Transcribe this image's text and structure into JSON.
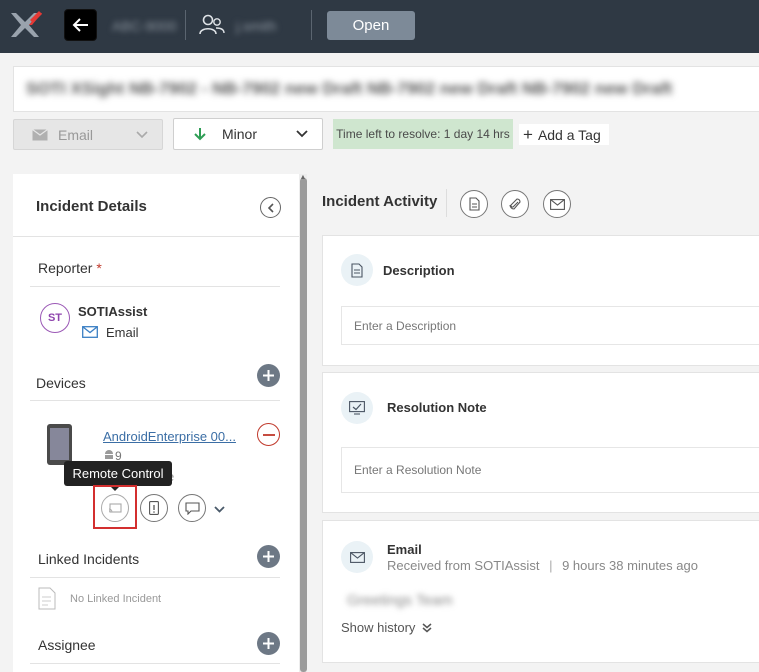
{
  "topbar": {
    "blurred_id": "ABC-9000",
    "blurred_name": "j.smith",
    "open_label": "Open"
  },
  "incident": {
    "title": "SOTI XSight NB-7902 - NB-7902 new Draft NB-7902 new Draft NB-7902 new Draft"
  },
  "toolbar": {
    "channel": "Email",
    "priority": "Minor",
    "time_left": "Time left to resolve: 1 day 14 hrs",
    "add_tag": "Add a Tag"
  },
  "details": {
    "title": "Incident Details",
    "reporter_label": "Reporter",
    "reporter_required": "*",
    "reporter_initials": "ST",
    "reporter_name": "SOTIAssist",
    "reporter_channel": "Email",
    "devices_label": "Devices",
    "device_name": "AndroidEnterprise 00...",
    "device_os_version": "9",
    "device_sub": "ance",
    "tooltip": "Remote Control",
    "linked_label": "Linked Incidents",
    "no_linked": "No Linked Incident",
    "assignee_label": "Assignee"
  },
  "activity": {
    "title": "Incident Activity",
    "description_label": "Description",
    "description_placeholder": "Enter a Description",
    "resolution_label": "Resolution Note",
    "resolution_placeholder": "Enter a Resolution Note",
    "email_label": "Email",
    "email_from": "Received from SOTIAssist",
    "email_sep": "|",
    "email_time": "9 hours 38 minutes ago",
    "email_blurred": "Greetings Team",
    "show_history": "Show history"
  },
  "colors": {
    "topbar": "#2f3944",
    "accent_red": "#d32f2f",
    "time_left_bg": "#cfe6cf",
    "link": "#3b6ea5"
  }
}
